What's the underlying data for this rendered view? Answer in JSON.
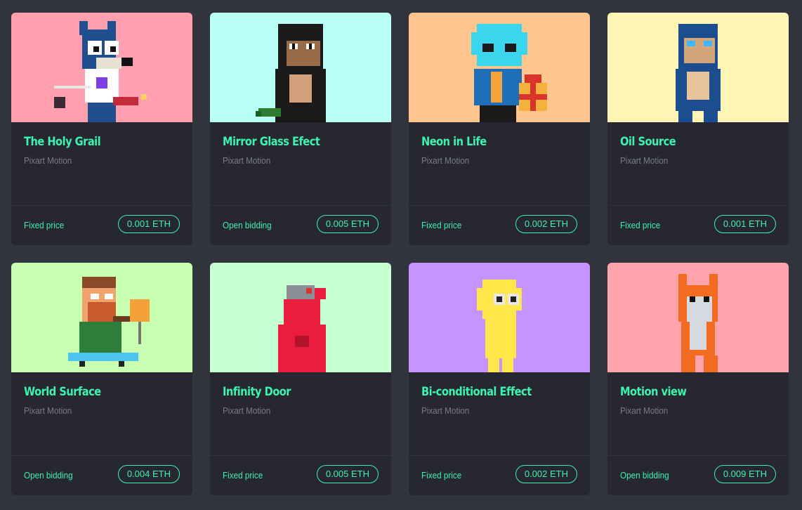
{
  "cards": [
    {
      "title": "The Holy Grail",
      "creator": "Pixart Motion",
      "sale_type": "Fixed price",
      "price": "0.001 ETH",
      "bg": "#ff9fb0",
      "art_icon": "wolf-pixel-icon"
    },
    {
      "title": "Mirror Glass Efect",
      "creator": "Pixart Motion",
      "sale_type": "Open bidding",
      "price": "0.005 ETH",
      "bg": "#b8fff6",
      "art_icon": "ape-pixel-icon"
    },
    {
      "title": "Neon in Life",
      "creator": "Pixart Motion",
      "sale_type": "Fixed price",
      "price": "0.002 ETH",
      "bg": "#ffc58f",
      "art_icon": "alien-pixel-icon"
    },
    {
      "title": "Oil Source",
      "creator": "Pixart Motion",
      "sale_type": "Fixed price",
      "price": "0.001 ETH",
      "bg": "#fff6b5",
      "art_icon": "ape-blue-pixel-icon"
    },
    {
      "title": "World Surface",
      "creator": "Pixart Motion",
      "sale_type": "Open bidding",
      "price": "0.004 ETH",
      "bg": "#c8ffb0",
      "art_icon": "skater-pixel-icon"
    },
    {
      "title": "Infinity Door",
      "creator": "Pixart Motion",
      "sale_type": "Fixed price",
      "price": "0.005 ETH",
      "bg": "#c6ffd2",
      "art_icon": "robot-bear-pixel-icon"
    },
    {
      "title": "Bi-conditional Effect",
      "creator": "Pixart Motion",
      "sale_type": "Fixed price",
      "price": "0.002 ETH",
      "bg": "#c594ff",
      "art_icon": "yellow-figure-pixel-icon"
    },
    {
      "title": "Motion view",
      "creator": "Pixart Motion",
      "sale_type": "Open bidding",
      "price": "0.009 ETH",
      "bg": "#ffa3ad",
      "art_icon": "fox-pixel-icon"
    }
  ],
  "colors": {
    "accent": "#3ef2b0",
    "card_bg": "#262730",
    "page_bg": "#31333d"
  }
}
